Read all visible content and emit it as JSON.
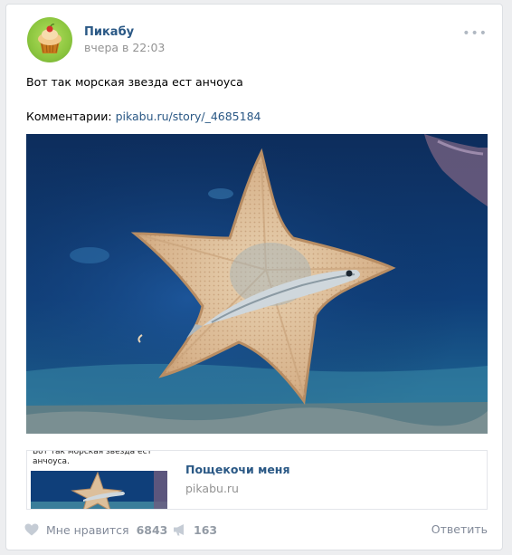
{
  "post": {
    "author": "Пикабу",
    "time": "вчера в 22:03",
    "text": "Вот так морская звезда ест анчоуса",
    "comments_label": "Комментарии:",
    "comments_link": "pikabu.ru/story/_4685184"
  },
  "snippet": {
    "thumb_text": "Вот так морская звезда ест анчоуса.",
    "title": "Пощекочи меня",
    "domain": "pikabu.ru"
  },
  "actions": {
    "like_label": "Мне нравится",
    "like_count": "6843",
    "share_count": "163",
    "reply_label": "Ответить"
  },
  "icons": {
    "more": "more-icon",
    "heart": "heart-icon",
    "share": "megaphone-icon"
  },
  "colors": {
    "link": "#2a5885",
    "muted": "#939393",
    "action": "#828a99",
    "background": "#edeef0"
  }
}
